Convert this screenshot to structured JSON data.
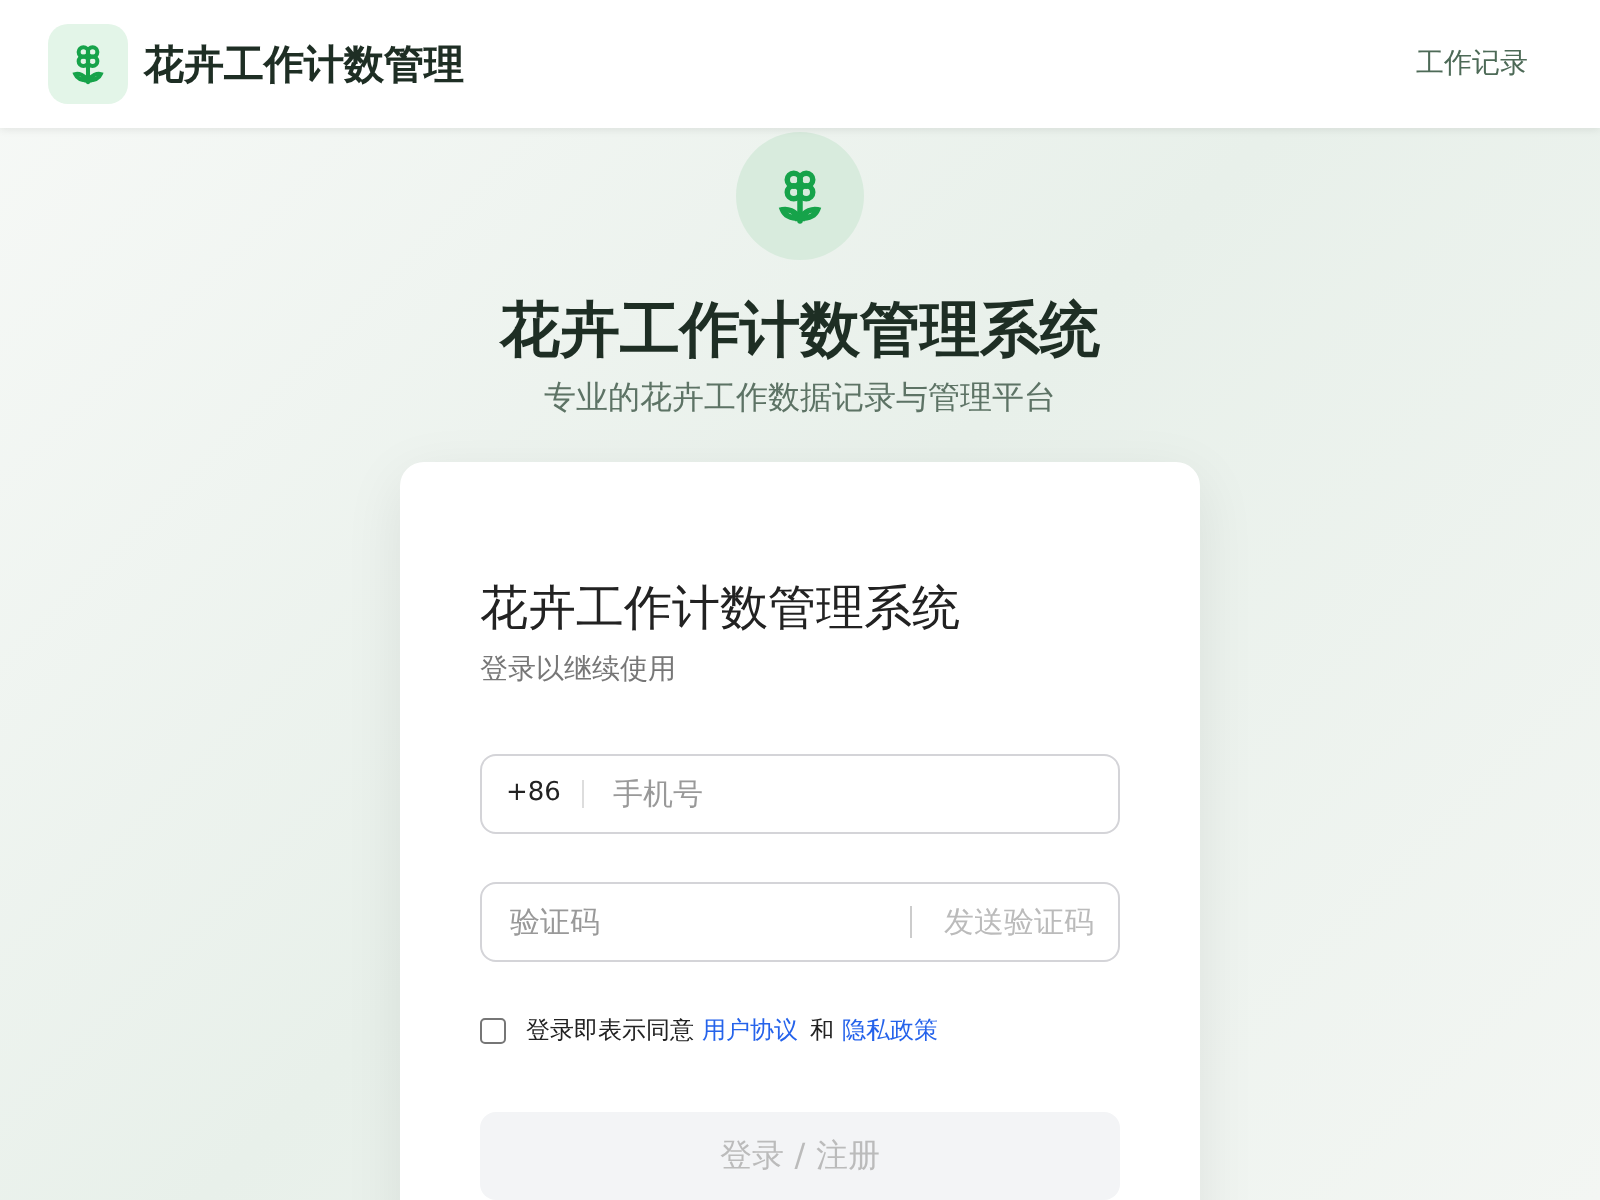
{
  "header": {
    "app_name": "花卉工作计数管理",
    "nav_link": "工作记录"
  },
  "hero": {
    "title": "花卉工作计数管理系统",
    "subtitle": "专业的花卉工作数据记录与管理平台"
  },
  "login_card": {
    "title": "花卉工作计数管理系统",
    "subtitle": "登录以继续使用",
    "phone_field": {
      "prefix": "+86",
      "placeholder": "手机号"
    },
    "code_field": {
      "placeholder": "验证码",
      "send_button": {
        "label": "发送验证码",
        "disabled": true
      }
    },
    "agreement": {
      "checked": false,
      "text": "登录即表示同意",
      "link_1": "用户协议",
      "conjunction": "和",
      "link_2": "隐私政策"
    },
    "submit_button": {
      "label": "登录 / 注册",
      "disabled": true
    }
  }
}
